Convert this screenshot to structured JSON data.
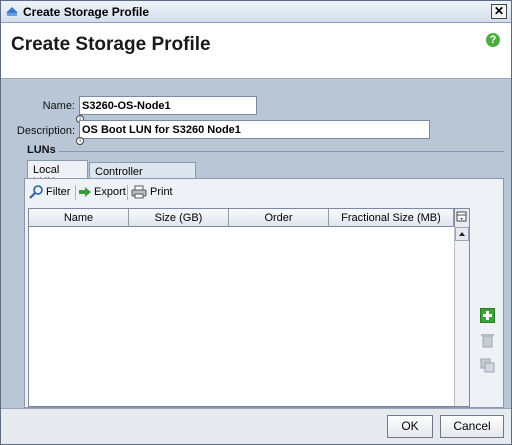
{
  "window": {
    "title": "Create Storage Profile"
  },
  "header": {
    "title": "Create Storage Profile",
    "help_glyph": "?"
  },
  "form": {
    "name_label": "Name:",
    "name_value": "S3260-OS-Node1",
    "description_label": "Description:",
    "description_value": "OS Boot LUN for S3260 Node1"
  },
  "luns": {
    "group_label": "LUNs",
    "tabs": [
      {
        "label": "Local LUNs",
        "active": true
      },
      {
        "label": "Controller Definitions",
        "active": false
      }
    ],
    "toolbar": {
      "filter_label": "Filter",
      "export_label": "Export",
      "print_label": "Print"
    },
    "columns": [
      "Name",
      "Size (GB)",
      "Order",
      "Fractional Size (MB)"
    ],
    "rows": []
  },
  "footer": {
    "ok_label": "OK",
    "cancel_label": "Cancel"
  },
  "icons": {
    "add": "add-icon",
    "delete": "delete-icon",
    "properties": "properties-icon"
  },
  "colors": {
    "window_bg": "#b9c6d6",
    "add_green": "#3da23a"
  }
}
